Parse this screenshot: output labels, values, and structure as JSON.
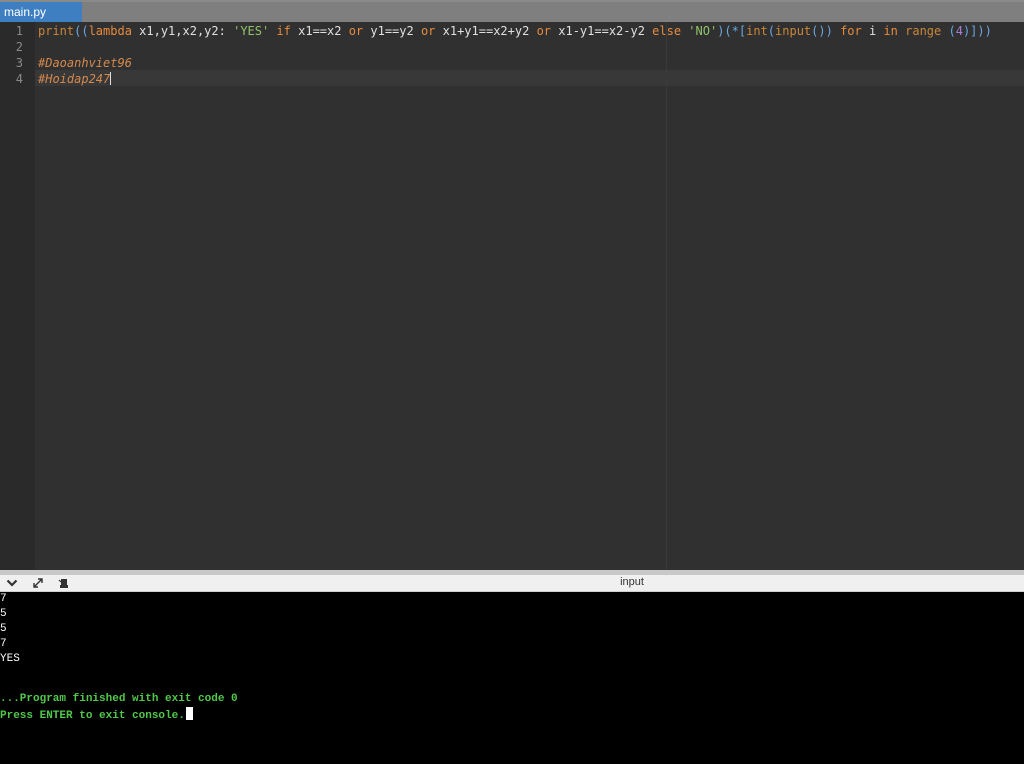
{
  "window": {
    "tab": {
      "label": "main.py",
      "active_color": "#3e7fc1"
    }
  },
  "editor": {
    "line_numbers": [
      "1",
      "2",
      "3",
      "4"
    ],
    "code_tokens": {
      "print": "print",
      "paren_open": "((",
      "lambda": "lambda",
      "params": " x1,y1,x2,y2: ",
      "yes": "'YES'",
      "if": " if ",
      "cond1": "x1==x2 ",
      "or1": "or",
      "cond2": " y1==y2 ",
      "or2": "or",
      "cond3": " x1+y1==x2+y2 ",
      "or3": "or",
      "cond4": " x1-y1==x2-y2 ",
      "else": "else",
      "no": " 'NO'",
      "star": ")(*[",
      "int": "int",
      "p1": "(",
      "input": "input",
      "p2": "()) ",
      "for": "for",
      "i": " i ",
      "in": "in",
      "range": " range",
      "four_open": " (",
      "four": "4",
      "tail": ")]))"
    },
    "comments": [
      "#Daoanhviet96",
      "#Hoidap247"
    ]
  },
  "console": {
    "toolbar": {
      "title": "input",
      "icons": [
        "chevron-down-icon",
        "expand-icon",
        "stop-icon"
      ]
    },
    "output": [
      "7",
      "5",
      "5",
      "7",
      "YES",
      "",
      ""
    ],
    "finish_lines": [
      "...Program finished with exit code 0",
      "Press ENTER to exit console."
    ],
    "colors": {
      "background": "#000000",
      "text": "#ffffff",
      "status": "#50c84a"
    }
  }
}
